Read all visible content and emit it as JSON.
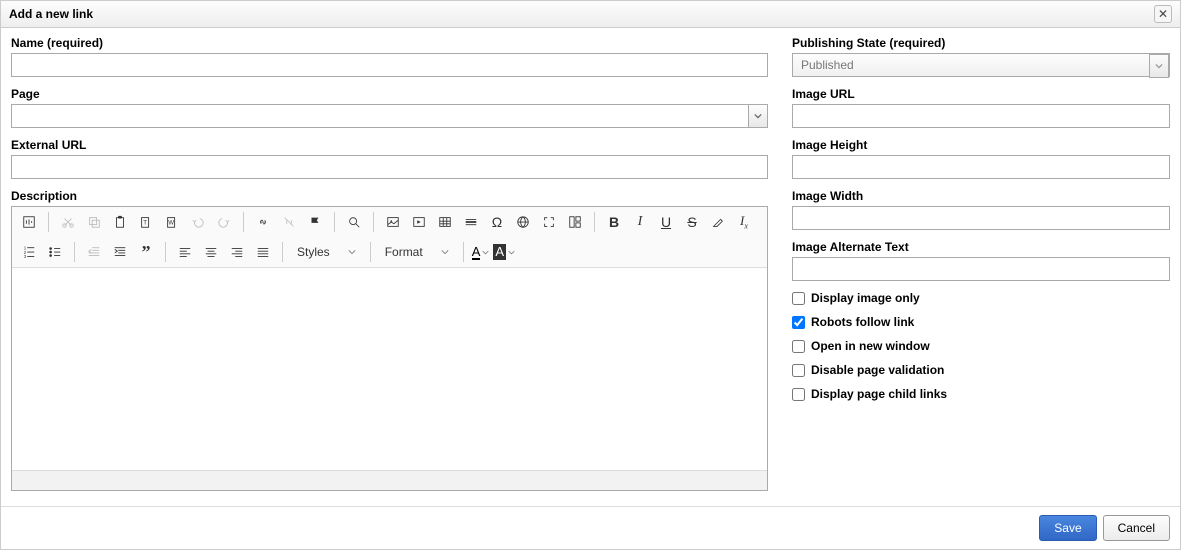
{
  "dialog": {
    "title": "Add a new link"
  },
  "leftCol": {
    "nameLabel": "Name (required)",
    "nameValue": "",
    "pageLabel": "Page",
    "pageValue": "",
    "externalUrlLabel": "External URL",
    "externalUrlValue": "",
    "descriptionLabel": "Description"
  },
  "editor": {
    "stylesLabel": "Styles",
    "formatLabel": "Format"
  },
  "rightCol": {
    "pubStateLabel": "Publishing State (required)",
    "pubStateValue": "Published",
    "imageUrlLabel": "Image URL",
    "imageUrlValue": "",
    "imageHeightLabel": "Image Height",
    "imageHeightValue": "",
    "imageWidthLabel": "Image Width",
    "imageWidthValue": "",
    "imageAltLabel": "Image Alternate Text",
    "imageAltValue": "",
    "cbDisplayImageOnly": "Display image only",
    "cbRobotsFollow": "Robots follow link",
    "cbOpenNewWindow": "Open in new window",
    "cbDisableValidation": "Disable page validation",
    "cbDisplayChildLinks": "Display page child links"
  },
  "checkboxStates": {
    "displayImageOnly": false,
    "robotsFollow": true,
    "openNewWindow": false,
    "disableValidation": false,
    "displayChildLinks": false
  },
  "footer": {
    "saveLabel": "Save",
    "cancelLabel": "Cancel"
  }
}
